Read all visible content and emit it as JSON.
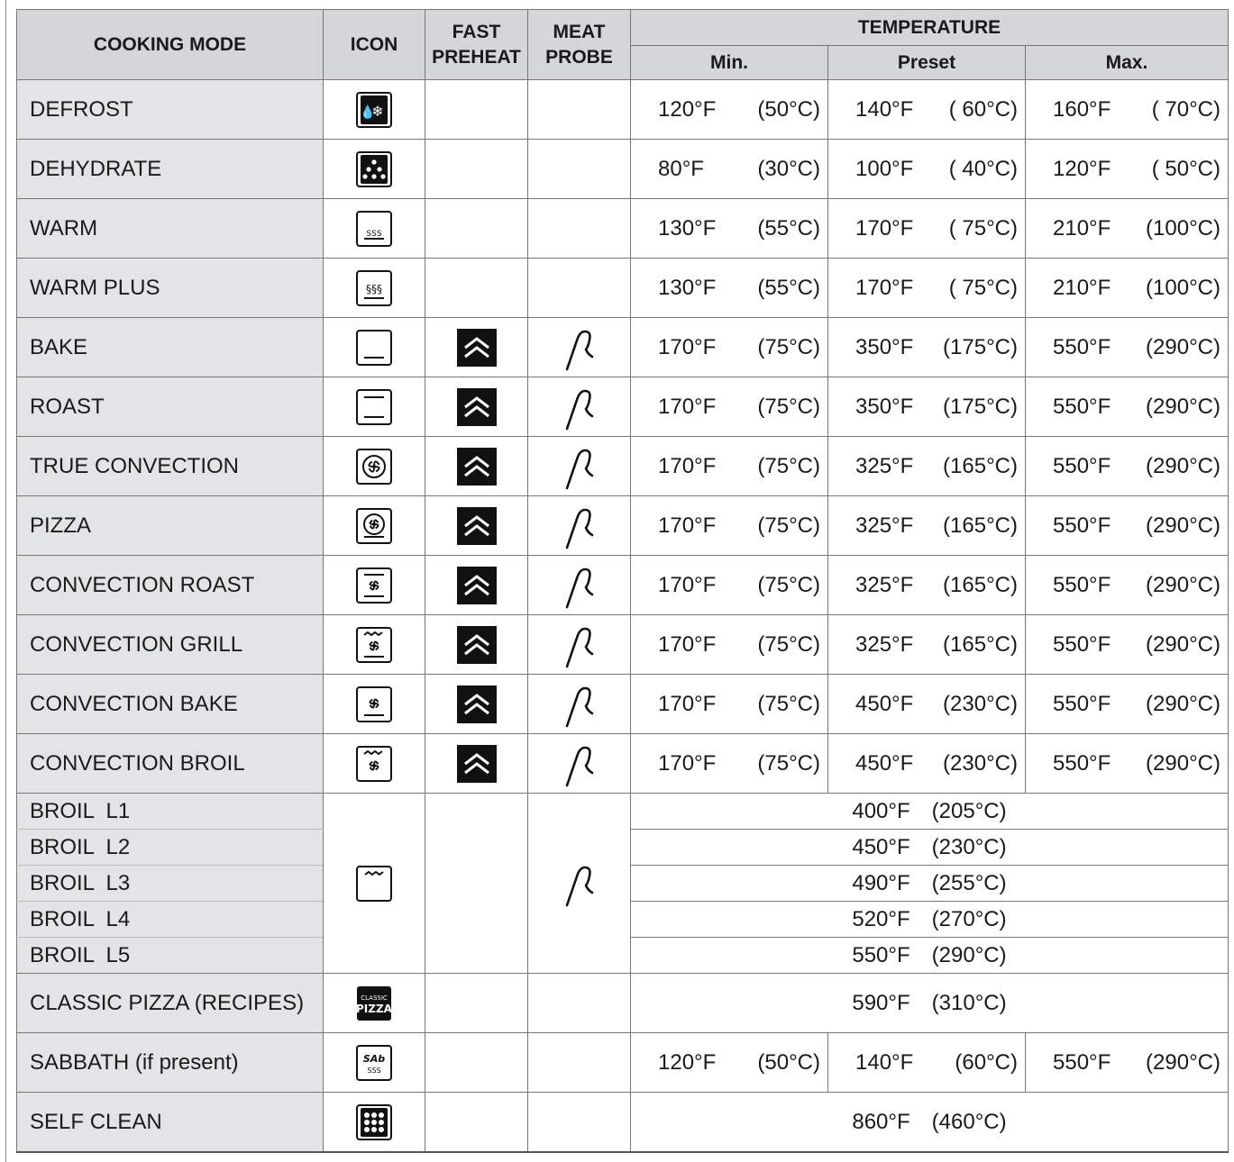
{
  "headers": {
    "mode": "COOKING MODE",
    "icon": "ICON",
    "fast_preheat": "FAST PREHEAT",
    "meat_probe": "MEAT PROBE",
    "temperature": "TEMPERATURE",
    "min": "Min.",
    "preset": "Preset",
    "max": "Max."
  },
  "rows": [
    {
      "mode": "DEFROST",
      "icon": "defrost-icon",
      "fast_preheat": false,
      "probe": false,
      "min": [
        "120°F",
        "(50°C)"
      ],
      "preset": [
        "140°F",
        "( 60°C)"
      ],
      "max": [
        "160°F",
        "( 70°C)"
      ]
    },
    {
      "mode": "DEHYDRATE",
      "icon": "dehydrate-icon",
      "fast_preheat": false,
      "probe": false,
      "min": [
        "80°F",
        "(30°C)"
      ],
      "preset": [
        "100°F",
        "( 40°C)"
      ],
      "max": [
        "120°F",
        "( 50°C)"
      ]
    },
    {
      "mode": "WARM",
      "icon": "warm-icon",
      "fast_preheat": false,
      "probe": false,
      "min": [
        "130°F",
        "(55°C)"
      ],
      "preset": [
        "170°F",
        "( 75°C)"
      ],
      "max": [
        "210°F",
        "(100°C)"
      ]
    },
    {
      "mode": "WARM PLUS",
      "icon": "warm-plus-icon",
      "fast_preheat": false,
      "probe": false,
      "min": [
        "130°F",
        "(55°C)"
      ],
      "preset": [
        "170°F",
        "( 75°C)"
      ],
      "max": [
        "210°F",
        "(100°C)"
      ]
    },
    {
      "mode": "BAKE",
      "icon": "bake-icon",
      "fast_preheat": true,
      "probe": true,
      "min": [
        "170°F",
        "(75°C)"
      ],
      "preset": [
        "350°F",
        "(175°C)"
      ],
      "max": [
        "550°F",
        "(290°C)"
      ]
    },
    {
      "mode": "ROAST",
      "icon": "roast-icon",
      "fast_preheat": true,
      "probe": true,
      "min": [
        "170°F",
        "(75°C)"
      ],
      "preset": [
        "350°F",
        "(175°C)"
      ],
      "max": [
        "550°F",
        "(290°C)"
      ]
    },
    {
      "mode": "TRUE CONVECTION",
      "icon": "true-convection-icon",
      "fast_preheat": true,
      "probe": true,
      "min": [
        "170°F",
        "(75°C)"
      ],
      "preset": [
        "325°F",
        "(165°C)"
      ],
      "max": [
        "550°F",
        "(290°C)"
      ]
    },
    {
      "mode": "PIZZA",
      "icon": "pizza-icon",
      "fast_preheat": true,
      "probe": true,
      "min": [
        "170°F",
        "(75°C)"
      ],
      "preset": [
        "325°F",
        "(165°C)"
      ],
      "max": [
        "550°F",
        "(290°C)"
      ]
    },
    {
      "mode": "CONVECTION ROAST",
      "icon": "convection-roast-icon",
      "fast_preheat": true,
      "probe": true,
      "min": [
        "170°F",
        "(75°C)"
      ],
      "preset": [
        "325°F",
        "(165°C)"
      ],
      "max": [
        "550°F",
        "(290°C)"
      ]
    },
    {
      "mode": "CONVECTION GRILL",
      "icon": "convection-grill-icon",
      "fast_preheat": true,
      "probe": true,
      "min": [
        "170°F",
        "(75°C)"
      ],
      "preset": [
        "325°F",
        "(165°C)"
      ],
      "max": [
        "550°F",
        "(290°C)"
      ]
    },
    {
      "mode": "CONVECTION BAKE",
      "icon": "convection-bake-icon",
      "fast_preheat": true,
      "probe": true,
      "min": [
        "170°F",
        "(75°C)"
      ],
      "preset": [
        "450°F",
        "(230°C)"
      ],
      "max": [
        "550°F",
        "(290°C)"
      ]
    },
    {
      "mode": "CONVECTION BROIL",
      "icon": "convection-broil-icon",
      "fast_preheat": true,
      "probe": true,
      "min": [
        "170°F",
        "(75°C)"
      ],
      "preset": [
        "450°F",
        "(230°C)"
      ],
      "max": [
        "550°F",
        "(290°C)"
      ]
    }
  ],
  "broil": {
    "icon": "broil-icon",
    "probe": true,
    "levels": [
      {
        "mode": "BROIL  L1",
        "temp": [
          "400°F",
          "(205°C)"
        ]
      },
      {
        "mode": "BROIL  L2",
        "temp": [
          "450°F",
          "(230°C)"
        ]
      },
      {
        "mode": "BROIL  L3",
        "temp": [
          "490°F",
          "(255°C)"
        ]
      },
      {
        "mode": "BROIL  L4",
        "temp": [
          "520°F",
          "(270°C)"
        ]
      },
      {
        "mode": "BROIL  L5",
        "temp": [
          "550°F",
          "(290°C)"
        ]
      }
    ]
  },
  "classic_pizza": {
    "mode": "CLASSIC PIZZA (RECIPES)",
    "icon": "classic-pizza-icon",
    "icon_text": [
      "CLASSIC",
      "PIZZA"
    ],
    "temp": [
      "590°F",
      "(310°C)"
    ]
  },
  "sabbath": {
    "mode": "SABBATH (if present)",
    "icon": "sabbath-icon",
    "icon_text": "SAb",
    "min": [
      "120°F",
      "(50°C)"
    ],
    "preset": [
      "140°F",
      "(60°C)"
    ],
    "max": [
      "550°F",
      "(290°C)"
    ]
  },
  "self_clean": {
    "mode": "SELF CLEAN",
    "icon": "self-clean-icon",
    "temp": [
      "860°F",
      "(460°C)"
    ]
  }
}
